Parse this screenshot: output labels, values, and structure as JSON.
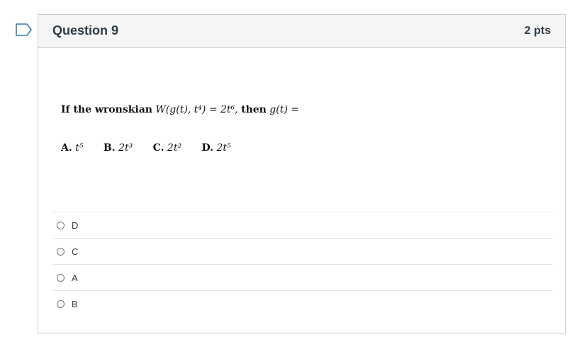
{
  "question": {
    "title": "Question 9",
    "points": "2 pts",
    "prompt_prefix": "If the wronskian",
    "prompt_formula": "W(g(t), t⁴) = 2t⁶,",
    "prompt_then": "then",
    "prompt_result": "g(t) =",
    "choices": [
      {
        "letter": "A.",
        "expr": "t⁵"
      },
      {
        "letter": "B.",
        "expr": "2t³"
      },
      {
        "letter": "C.",
        "expr": "2t²"
      },
      {
        "letter": "D.",
        "expr": "2t⁵"
      }
    ]
  },
  "answers": [
    {
      "label": "D"
    },
    {
      "label": "C"
    },
    {
      "label": "A"
    },
    {
      "label": "B"
    }
  ],
  "colors": {
    "flag": "#2b7abc",
    "header_bg": "#f5f5f5",
    "border": "#c7cdd1"
  }
}
